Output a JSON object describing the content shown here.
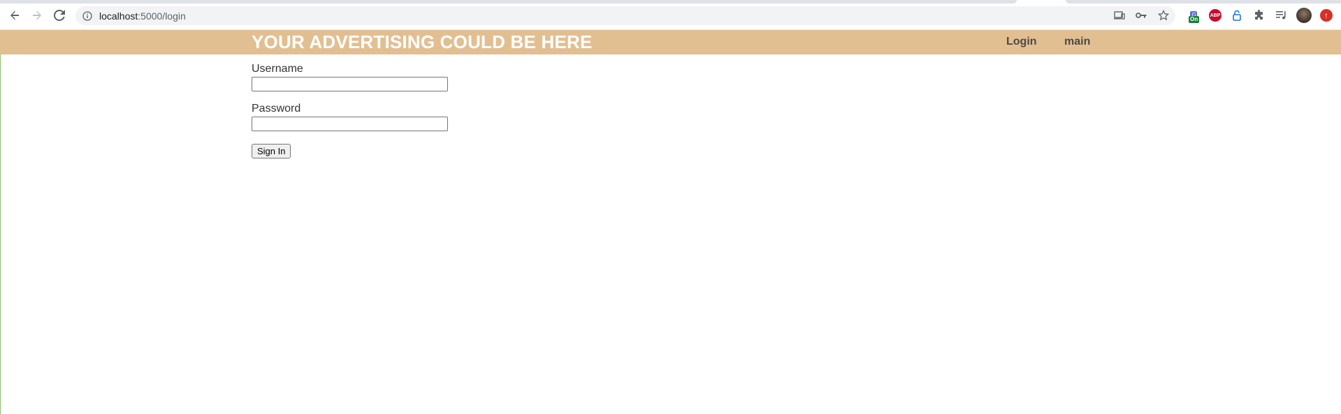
{
  "browser": {
    "url_host": "localhost",
    "url_rest": ":5000/login",
    "extensions": [
      {
        "icon": "google-translate-icon",
        "badge": "On"
      },
      {
        "icon": "adblock-plus-icon",
        "label": "ABP"
      },
      {
        "icon": "lock-extension-icon"
      },
      {
        "icon": "puzzle-extensions-icon"
      },
      {
        "icon": "media-queue-icon"
      },
      {
        "icon": "profile-avatar"
      },
      {
        "icon": "update-icon"
      }
    ]
  },
  "site": {
    "title": "YOUR ADVERTISING COULD BE HERE",
    "header_color": "#e2bf91",
    "nav": {
      "login": "Login",
      "main": "main"
    }
  },
  "form": {
    "username_label": "Username",
    "username_value": "",
    "password_label": "Password",
    "password_value": "",
    "submit_label": "Sign In"
  }
}
